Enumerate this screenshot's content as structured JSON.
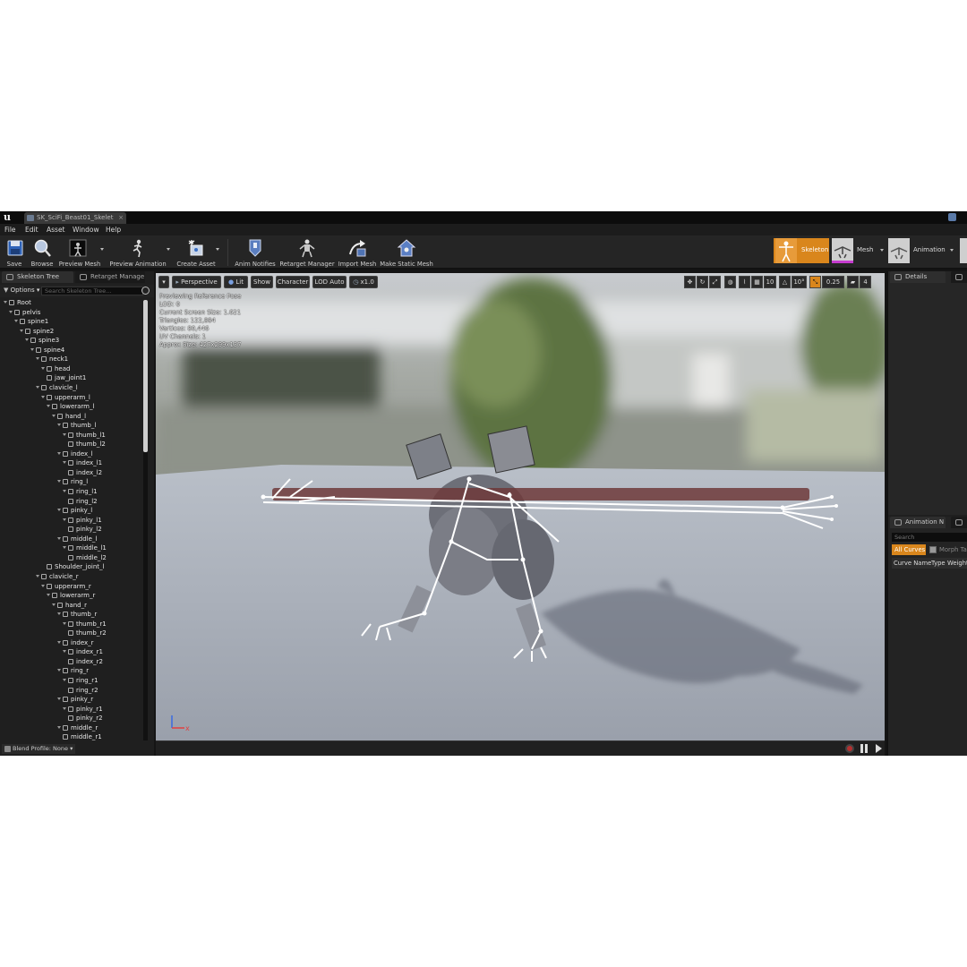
{
  "window": {
    "tab_title": "SK_SciFi_Beast01_Skelet",
    "tab_close": "×"
  },
  "menu": [
    "File",
    "Edit",
    "Asset",
    "Window",
    "Help"
  ],
  "toolbar": {
    "save": "Save",
    "browse": "Browse",
    "preview_mesh": "Preview Mesh",
    "preview_animation": "Preview Animation",
    "create_asset": "Create Asset",
    "anim_notifies": "Anim Notifies",
    "retarget_manager": "Retarget Manager",
    "import_mesh": "Import Mesh",
    "make_static_mesh": "Make Static Mesh"
  },
  "modes": {
    "skeleton": "Skeleton",
    "mesh": "Mesh",
    "animation": "Animation",
    "active": "skeleton"
  },
  "left_panel": {
    "tab_skeleton_tree": "Skeleton Tree",
    "tab_retarget": "Retarget Manage",
    "options": "Options",
    "search_placeholder": "Search Skeleton Tree...",
    "blend_profile": "Blend Profile: None"
  },
  "bones": [
    {
      "name": "Root",
      "depth": 0
    },
    {
      "name": "pelvis",
      "depth": 1
    },
    {
      "name": "spine1",
      "depth": 2
    },
    {
      "name": "spine2",
      "depth": 3
    },
    {
      "name": "spine3",
      "depth": 4
    },
    {
      "name": "spine4",
      "depth": 5
    },
    {
      "name": "neck1",
      "depth": 6
    },
    {
      "name": "head",
      "depth": 7
    },
    {
      "name": "jaw_joint1",
      "depth": 8
    },
    {
      "name": "clavicle_l",
      "depth": 6
    },
    {
      "name": "upperarm_l",
      "depth": 7
    },
    {
      "name": "lowerarm_l",
      "depth": 8
    },
    {
      "name": "hand_l",
      "depth": 9
    },
    {
      "name": "thumb_l",
      "depth": 10
    },
    {
      "name": "thumb_l1",
      "depth": 11
    },
    {
      "name": "thumb_l2",
      "depth": 12
    },
    {
      "name": "index_l",
      "depth": 10
    },
    {
      "name": "index_l1",
      "depth": 11
    },
    {
      "name": "index_l2",
      "depth": 12
    },
    {
      "name": "ring_l",
      "depth": 10
    },
    {
      "name": "ring_l1",
      "depth": 11
    },
    {
      "name": "ring_l2",
      "depth": 12
    },
    {
      "name": "pinky_l",
      "depth": 10
    },
    {
      "name": "pinky_l1",
      "depth": 11
    },
    {
      "name": "pinky_l2",
      "depth": 12
    },
    {
      "name": "middle_l",
      "depth": 10
    },
    {
      "name": "middle_l1",
      "depth": 11
    },
    {
      "name": "middle_l2",
      "depth": 12
    },
    {
      "name": "Shoulder_joint_l",
      "depth": 8
    },
    {
      "name": "clavicle_r",
      "depth": 6
    },
    {
      "name": "upperarm_r",
      "depth": 7
    },
    {
      "name": "lowerarm_r",
      "depth": 8
    },
    {
      "name": "hand_r",
      "depth": 9
    },
    {
      "name": "thumb_r",
      "depth": 10
    },
    {
      "name": "thumb_r1",
      "depth": 11
    },
    {
      "name": "thumb_r2",
      "depth": 12
    },
    {
      "name": "index_r",
      "depth": 10
    },
    {
      "name": "index_r1",
      "depth": 11
    },
    {
      "name": "index_r2",
      "depth": 12
    },
    {
      "name": "ring_r",
      "depth": 10
    },
    {
      "name": "ring_r1",
      "depth": 11
    },
    {
      "name": "ring_r2",
      "depth": 12
    },
    {
      "name": "pinky_r",
      "depth": 10
    },
    {
      "name": "pinky_r1",
      "depth": 11
    },
    {
      "name": "pinky_r2",
      "depth": 12
    },
    {
      "name": "middle_r",
      "depth": 10
    },
    {
      "name": "middle_r1",
      "depth": 11
    }
  ],
  "viewport": {
    "perspective": "Perspective",
    "lit": "Lit",
    "show": "Show",
    "character": "Character",
    "lod": "LOD Auto",
    "speed": "x1.0",
    "grid_size": "10",
    "rotation_snap": "10°",
    "scale_snap": "0.25",
    "camera_speed": "4",
    "axis_x": "x",
    "info": [
      "Previewing Reference Pose",
      "LOD: 0",
      "Current Screen Size: 1.621",
      "Triangles: 122,884",
      "Vertices: 80,446",
      "UV Channels: 1",
      "Approx Size: 427x299x137"
    ]
  },
  "right_panel": {
    "details_tab": "Details",
    "anim_tab": "Animation N",
    "search_placeholder": "Search",
    "all_curves": "All Curves",
    "morph_targets": "Morph Ta",
    "col_curve_name": "Curve Name",
    "col_type": "Type",
    "col_weight": "Weight"
  },
  "colors": {
    "accent": "#d9861c",
    "background": "#151515",
    "panel": "#1f1f1f"
  }
}
